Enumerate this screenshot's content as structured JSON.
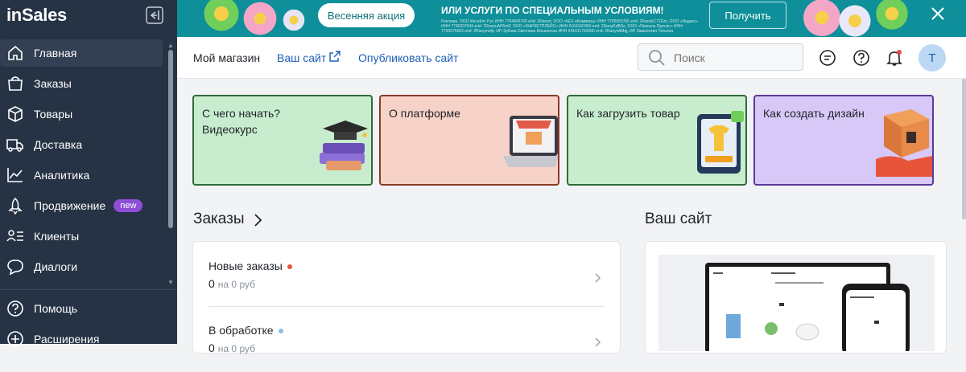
{
  "app": {
    "logo": "inSales"
  },
  "sidebar": {
    "items": [
      {
        "label": "Главная",
        "icon": "home-icon"
      },
      {
        "label": "Заказы",
        "icon": "bag-icon"
      },
      {
        "label": "Товары",
        "icon": "box-icon"
      },
      {
        "label": "Доставка",
        "icon": "truck-icon"
      },
      {
        "label": "Аналитика",
        "icon": "chart-icon"
      },
      {
        "label": "Продвижение",
        "icon": "rocket-icon",
        "badge": "new"
      },
      {
        "label": "Клиенты",
        "icon": "clients-icon"
      },
      {
        "label": "Диалоги",
        "icon": "chat-icon"
      },
      {
        "label": "Помощь",
        "icon": "help-icon"
      },
      {
        "label": "Расширения",
        "icon": "extensions-icon"
      }
    ]
  },
  "banner": {
    "promo_button": "Весенняя акция",
    "title": "ИЛИ УСЛУГИ ПО СПЕЦИАЛЬНЫМ УСЛОВИЯМ!",
    "fine_print": "Реклама. ООО Инсейлс Рус ИНН 7704843760 erid: 2Ranyn; ООО «КЕХ еКоммерц» ИНН 7705050765 erid: 2RanykC72Gm, ООО «Яндекс» ИНН 7736207543 erid: 2RanyuAP6mP, ООО «МАРКЕТПЛЕЙС» ИНН 6164160950 erid: 2RanyKdBSs, ООО «Пиксель Просис» ИНН 7735575603 erid: 2Ranymvfp, ИП Зубова Светлана Ильинична ИНН 541011762565 erid: 2Ranyn6Mqj, ИП Замолотин Татьяна Александровна ИНН 773579028 erid: 2Ranyn6Mgj, ...",
    "get_button": "Получить"
  },
  "header": {
    "store_name": "Мой магазин",
    "your_site_link": "Ваш сайт",
    "publish_link": "Опубликовать сайт",
    "search_placeholder": "Поиск",
    "avatar_letter": "Т"
  },
  "cards": [
    {
      "title": "С чего начать? Видеокурс",
      "bg": "#c8ecce",
      "border": "#2f6b3a"
    },
    {
      "title": "О платформе",
      "bg": "#f7d2c8",
      "border": "#8a3a2a"
    },
    {
      "title": "Как загрузить товар",
      "bg": "#c8ecce",
      "border": "#2f6b3a"
    },
    {
      "title": "Как создать дизайн",
      "bg": "#d8c8f7",
      "border": "#5b3a9a"
    }
  ],
  "orders": {
    "title": "Заказы",
    "rows": [
      {
        "label": "Новые заказы",
        "count": "0",
        "sub": "на 0 руб",
        "dot_color": "#e0573a"
      },
      {
        "label": "В обработке",
        "count": "0",
        "sub": "на 0 руб",
        "dot_color": "#8cc0ea"
      }
    ]
  },
  "site": {
    "title": "Ваш сайт"
  },
  "colors": {
    "sidebar_bg": "#263345",
    "banner_bg": "#0e8f9a",
    "link": "#1f5fb8",
    "badge": "#8d4fd8"
  }
}
